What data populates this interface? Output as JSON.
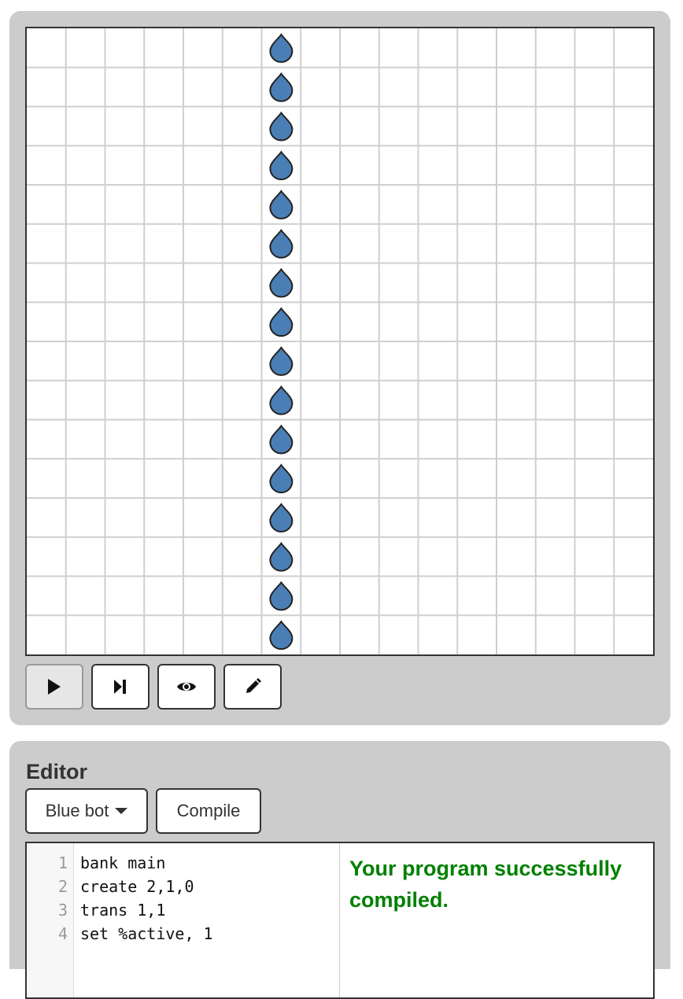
{
  "board": {
    "columns": 16,
    "rows": 16,
    "drop_column": 6,
    "drop_rows": [
      0,
      1,
      2,
      3,
      4,
      5,
      6,
      7,
      8,
      9,
      10,
      11,
      12,
      13,
      14,
      15
    ],
    "drop_color": "#4a7fb5",
    "drop_outline": "#222222",
    "grid_color": "#cfcfcf"
  },
  "controls": [
    {
      "name": "play-button",
      "icon": "play-icon",
      "active": true
    },
    {
      "name": "step-button",
      "icon": "step-forward-icon",
      "active": false
    },
    {
      "name": "view-button",
      "icon": "eye-icon",
      "active": false
    },
    {
      "name": "edit-button",
      "icon": "pencil-icon",
      "active": false
    }
  ],
  "editor": {
    "title": "Editor",
    "bot_select": "Blue bot",
    "compile_label": "Compile",
    "line_numbers": "1\n2\n3\n4",
    "code": "bank main\ncreate 2,1,0\ntrans 1,1\nset %active, 1",
    "status": "Your program successfully compiled.",
    "status_color": "#008000"
  }
}
